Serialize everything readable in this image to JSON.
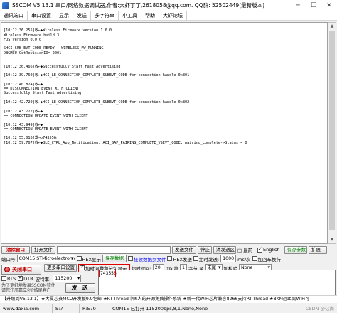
{
  "window": {
    "title": "SSCOM V5.13.1 串口/网络数据调试器,作者:大虾丁丁,2618058@qq.com. QQ群: 52502449(最新版本)",
    "minimize": "─",
    "maximize": "☐",
    "close": "✕"
  },
  "menu": [
    "通讯端口",
    "串口设置",
    "显示",
    "发送",
    "多字符串",
    "小工具",
    "帮助",
    "大虾论坛"
  ],
  "log": [
    "",
    "[10:12:36.255]收←◆Wireless Firmware version 1.0.0",
    "Wireless Firmware build 3",
    "FUS version 0.0.0",
    "",
    "SHCI_SUB_EVT_CODE_READY - WIRELESS_FW_RUNNING",
    "DBGMCU_GetRevisionID= 2001",
    "",
    "",
    "[10:12:36.466]收←◆Successfully Start Fast Advertising",
    "",
    "[10:12:39.760]收←◆HCI_LE_CONNECTION_COMPLETE_SUBEVT_CODE for connection handle 0x801",
    "",
    "[10:12:40.824]收←◆",
    "== DISCONNECTION EVENT WITH CLIENT",
    "Successfully Start Fast Advertising",
    "",
    "[10:12:42.729]收←◆HCI_LE_CONNECTION_COMPLETE_SUBEVT_CODE for connection handle 0x802",
    "",
    "[10:12:43.772]收←◆",
    "== CONNECTION UPDATE EVENT WITH CLIENT",
    "",
    "[10:12:43.949]收←◆",
    "== CONNECTION UPDATE EVENT WITH CLIENT",
    "",
    "[10:12:55.016]发→◇743556□",
    "[10:12:59.767]收←◆BLE_CTRL_App_Notification: ACI_GAP_PAIRING_COMPLETE_VSEVT_CODE, pairing_complete->Status = 0"
  ],
  "row1": {
    "clear_window": "清除窗口",
    "open_file": "打开文件",
    "send_file": "发送文件",
    "stop": "停止",
    "clear_send": "清发送区",
    "top_most": "□ 最前",
    "english": "English",
    "save_params": "保存参数",
    "expand": "扩展 —"
  },
  "row2": {
    "port_label": "端口号",
    "port_value": "COM15 STMicroelectronics S",
    "hex_display": "HEX显示",
    "save_data": "保存数据",
    "recv_to_file": "接收数据到文件",
    "hex_send": "HEX发送",
    "timed_send": "定时发送:",
    "interval": "1000",
    "interval_unit": "ms/次",
    "add_crlf": "加回车换行"
  },
  "row3": {
    "more_settings": "更多串口设置",
    "timestamp_label": "加时间戳和分包显示,",
    "timeout_label": "超时时间:",
    "timeout_value": "20",
    "timeout_unit": "ms",
    "byte_no": "第",
    "byte_value": "1",
    "byte_unit": "字节",
    "to": "至",
    "end": "末尾",
    "checksum": "加校验",
    "checksum_value": "None"
  },
  "close_port": "关闭串口",
  "rts": "RTS",
  "dtr": "DTR",
  "baud_label": "波特率:",
  "baud_value": "115200",
  "send_text": "743556",
  "send_button": "发 送",
  "promo": "为了更好地发展SSCOM软件\n请您注册嘉立创P结尾客户",
  "ticker": "【升级到V5.13.1】★大夏芯赛MCU开发板9.9包邮 ★RT-Thread中国人的开源免费操作系统 ★新一代WiFi芯片兼容8266支持RT-Thread ★8KM远距离WiFi可",
  "status": {
    "url": "www.daxia.com",
    "s": "S:7",
    "r": "R:579",
    "port": "COM15 已打开  115200bps,8,1,None,None",
    "watermark": "CSDN @亿尚"
  }
}
